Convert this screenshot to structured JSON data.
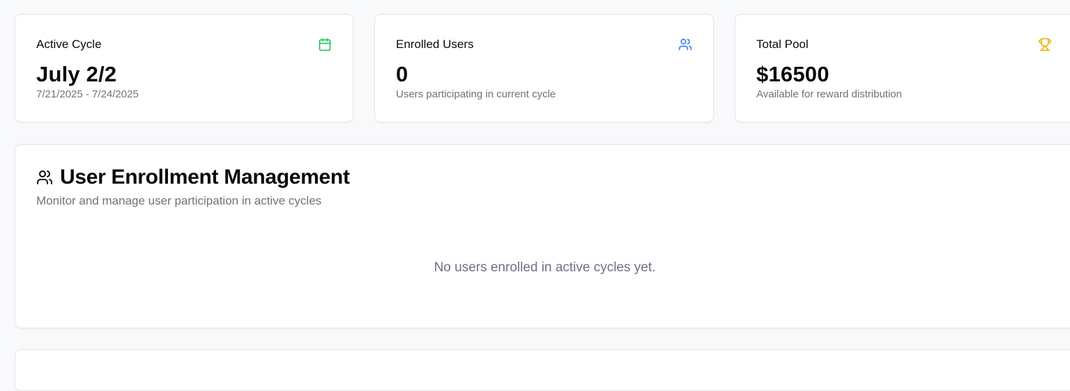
{
  "stats": [
    {
      "label": "Active Cycle",
      "value": "July 2/2",
      "sub": "7/21/2025 - 7/24/2025",
      "icon": "calendar-icon",
      "icon_color": "#22c55e"
    },
    {
      "label": "Enrolled Users",
      "value": "0",
      "sub": "Users participating in current cycle",
      "icon": "users-icon",
      "icon_color": "#3b82f6"
    },
    {
      "label": "Total Pool",
      "value": "$16500",
      "sub": "Available for reward distribution",
      "icon": "trophy-icon",
      "icon_color": "#eab308"
    }
  ],
  "enrollment": {
    "title": "User Enrollment Management",
    "description": "Monitor and manage user participation in active cycles",
    "empty_message": "No users enrolled in active cycles yet.",
    "icon": "users-icon"
  }
}
